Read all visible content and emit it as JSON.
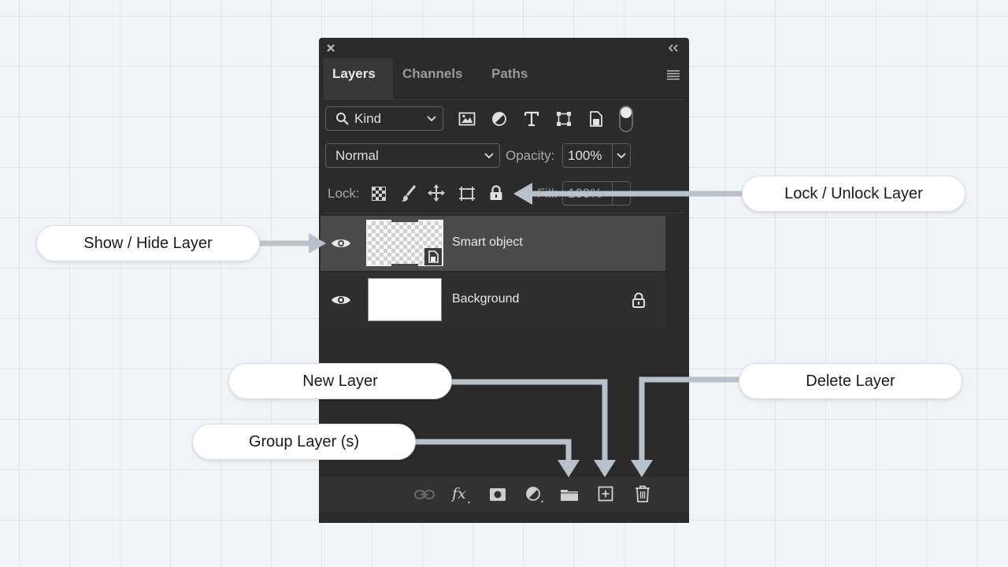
{
  "panel": {
    "tabs": [
      {
        "label": "Layers",
        "active": true
      },
      {
        "label": "Channels",
        "active": false
      },
      {
        "label": "Paths",
        "active": false
      }
    ],
    "filter": {
      "kind_label": "Kind"
    },
    "blend_mode": "Normal",
    "opacity_label": "Opacity:",
    "opacity_value": "100%",
    "lock_label": "Lock:",
    "fill_label": "Fill:",
    "fill_value": "100%",
    "layers": [
      {
        "name": "Smart object",
        "selected": true,
        "visible": true,
        "locked": false,
        "thumbnail": "transparent-checker"
      },
      {
        "name": "Background",
        "selected": false,
        "visible": true,
        "locked": true,
        "thumbnail": "white"
      }
    ]
  },
  "callouts": {
    "show_hide": "Show / Hide Layer",
    "lock_unlock": "Lock / Unlock Layer",
    "new_layer": "New Layer",
    "delete_layer": "Delete Layer",
    "group_layer": "Group Layer (s)"
  },
  "colors": {
    "panel_bg": "#2b2b2b",
    "selected_row": "#4a4a4a",
    "arrow": "#b9c1cb",
    "canvas_bg": "#f1f4f7"
  }
}
